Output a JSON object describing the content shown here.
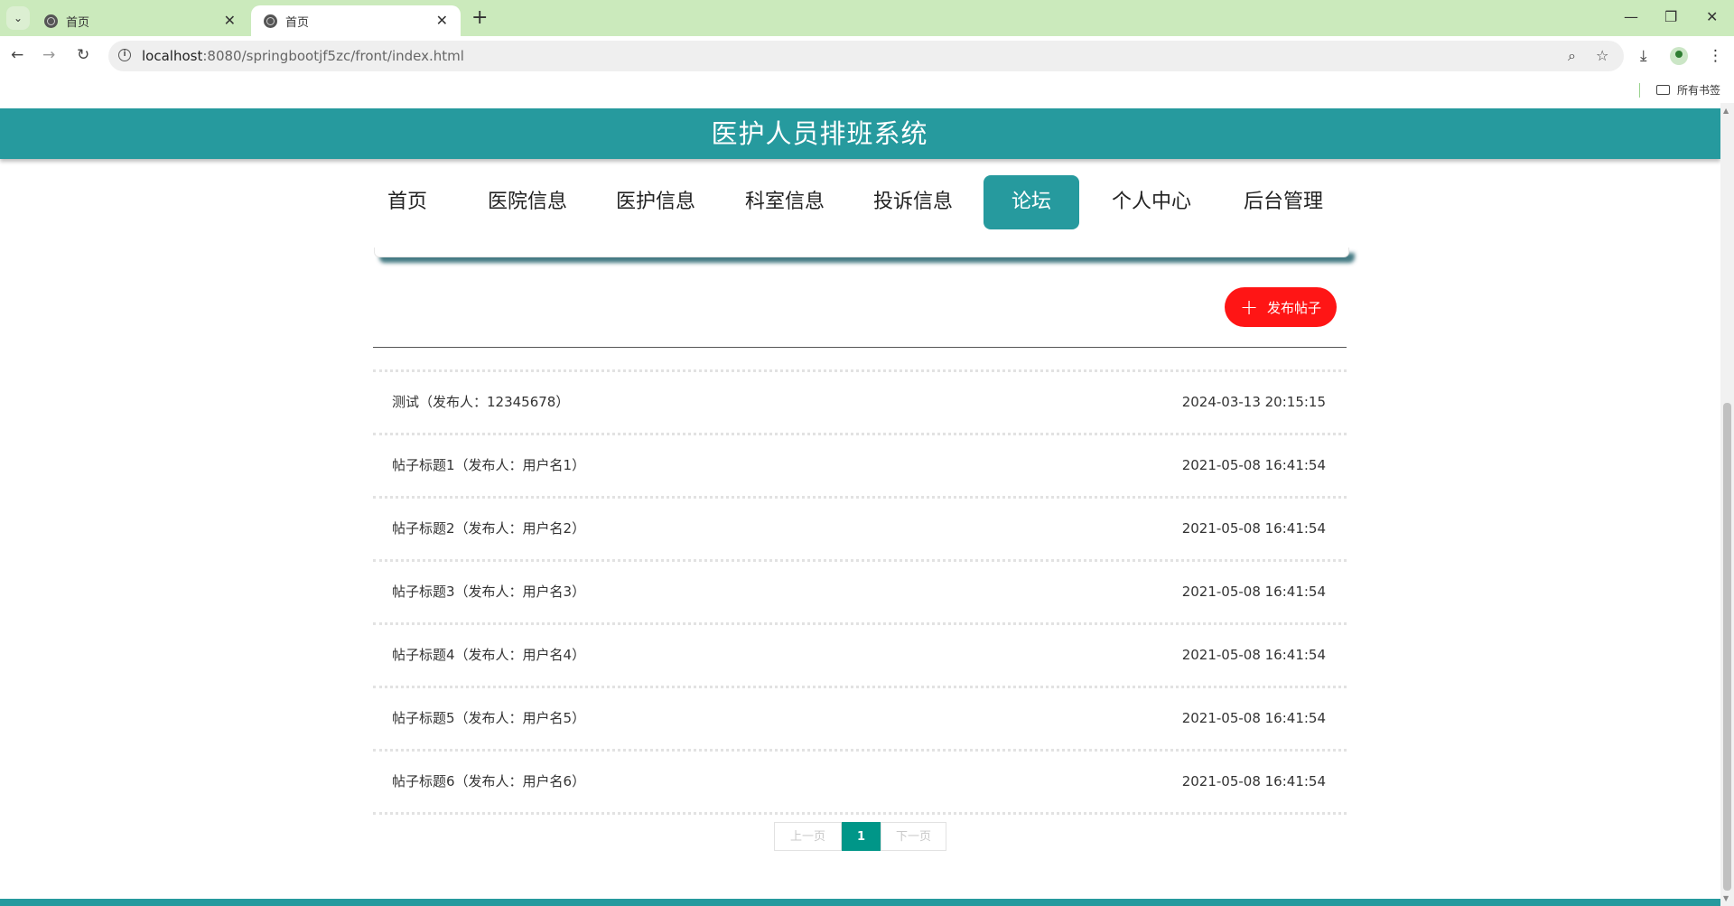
{
  "browser": {
    "tabs": [
      {
        "title": "首页",
        "active": false
      },
      {
        "title": "首页",
        "active": true
      }
    ],
    "new_tab_icon": "plus-icon",
    "url_host": "localhost",
    "url_rest": ":8080/springbootjf5zc/front/index.html",
    "bookmarks_label": "所有书签"
  },
  "site": {
    "title": "医护人员排班系统",
    "brand_color": "#269a9e"
  },
  "nav": {
    "items": [
      {
        "label": "首页"
      },
      {
        "label": "医院信息"
      },
      {
        "label": "医护信息"
      },
      {
        "label": "科室信息"
      },
      {
        "label": "投诉信息"
      },
      {
        "label": "论坛",
        "active": true
      },
      {
        "label": "个人中心"
      },
      {
        "label": "后台管理"
      }
    ]
  },
  "forum": {
    "publish_label": "发布帖子",
    "publish_color": "#ff1515",
    "posts": [
      {
        "title": "测试（发布人：12345678）",
        "time": "2024-03-13 20:15:15"
      },
      {
        "title": "帖子标题1（发布人：用户名1）",
        "time": "2021-05-08 16:41:54"
      },
      {
        "title": "帖子标题2（发布人：用户名2）",
        "time": "2021-05-08 16:41:54"
      },
      {
        "title": "帖子标题3（发布人：用户名3）",
        "time": "2021-05-08 16:41:54"
      },
      {
        "title": "帖子标题4（发布人：用户名4）",
        "time": "2021-05-08 16:41:54"
      },
      {
        "title": "帖子标题5（发布人：用户名5）",
        "time": "2021-05-08 16:41:54"
      },
      {
        "title": "帖子标题6（发布人：用户名6）",
        "time": "2021-05-08 16:41:54"
      }
    ]
  },
  "pager": {
    "prev_label": "上一页",
    "current_page": "1",
    "next_label": "下一页"
  }
}
